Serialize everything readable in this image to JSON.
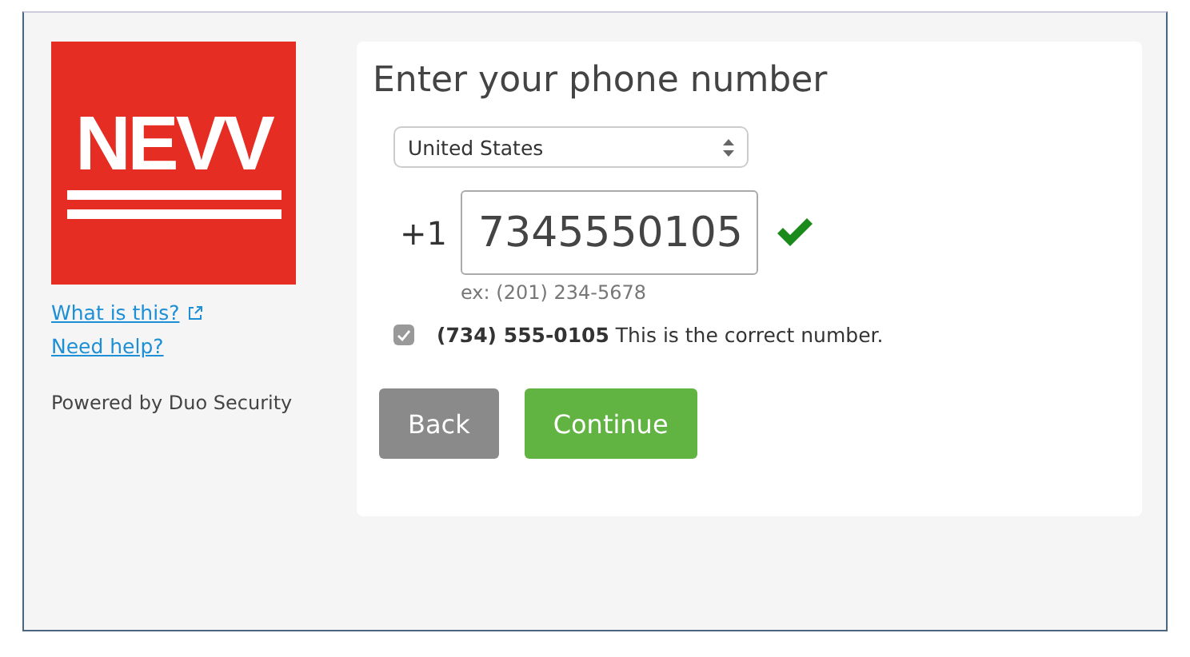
{
  "sidebar": {
    "logo": "NEVV",
    "links": [
      {
        "label": "What is this?",
        "external": true
      },
      {
        "label": "Need help?",
        "external": false
      }
    ],
    "powered_by": "Powered by Duo Security"
  },
  "form": {
    "title": "Enter your phone number",
    "country": "United States",
    "prefix": "+1",
    "phone": "7345550105",
    "valid": true,
    "hint": "ex: (201) 234-5678",
    "confirm": {
      "checked": true,
      "text": "**(734) 555-0105** This is the correct number."
    },
    "buttons": [
      {
        "label": "Back",
        "kind": "secondary"
      },
      {
        "label": "Continue",
        "kind": "primary"
      }
    ]
  }
}
